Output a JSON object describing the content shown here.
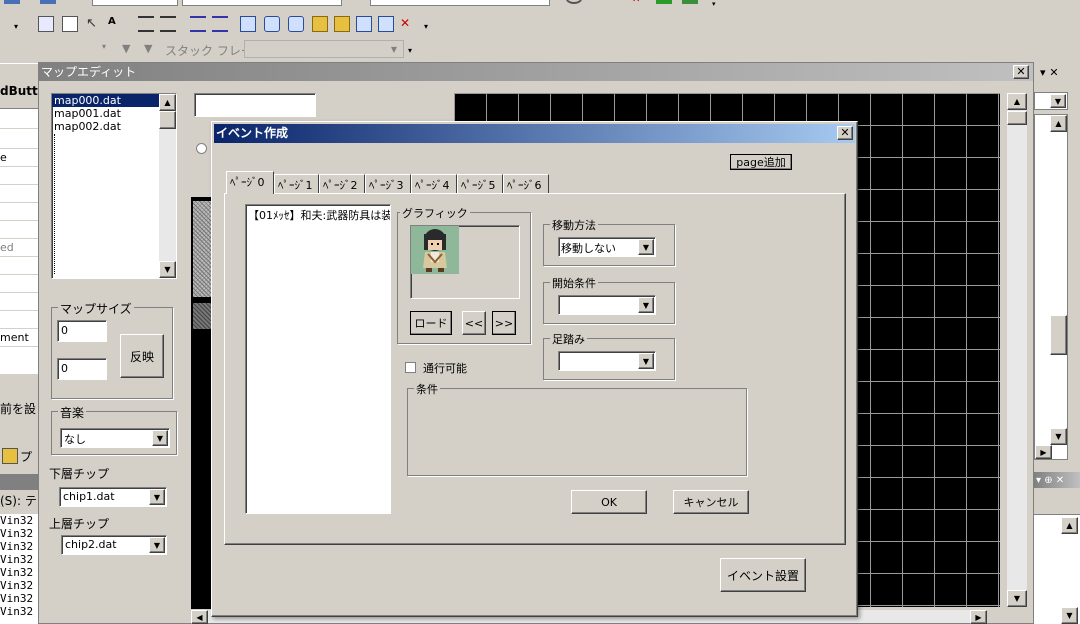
{
  "toolbar": {
    "stack_frame_label": "スタック フレーム"
  },
  "left_panel": {
    "fragments": [
      "dButto",
      "e",
      "ed",
      "ment",
      "前を設",
      "プ",
      "(S): テ"
    ],
    "win32_items": [
      "Vin32",
      "Vin32",
      "Vin32",
      "Vin32",
      "Vin32",
      "Vin32",
      "Vin32",
      "Vin32"
    ]
  },
  "map_editor": {
    "title": "マップエディット",
    "close_glyph": "✕",
    "files": [
      "map000.dat",
      "map001.dat",
      "map002.dat"
    ],
    "map_size_label": "マップサイズ",
    "width_value": "0",
    "height_value": "0",
    "apply_button": "反映",
    "music_label": "音楽",
    "music_value": "なし",
    "lower_chip_label": "下層チップ",
    "lower_chip_value": "chip1.dat",
    "upper_chip_label": "上層チップ",
    "upper_chip_value": "chip2.dat"
  },
  "event_dialog": {
    "title": "イベント作成",
    "close_glyph": "✕",
    "add_page_button": "page追加",
    "tabs": [
      "ﾍﾟｰｼﾞ0",
      "ﾍﾟｰｼﾞ1",
      "ﾍﾟｰｼﾞ2",
      "ﾍﾟｰｼﾞ3",
      "ﾍﾟｰｼﾞ4",
      "ﾍﾟｰｼﾞ5",
      "ﾍﾟｰｼﾞ6"
    ],
    "command_item": "【01ﾒｯｾ】和夫:武器防具は装",
    "graphic_label": "グラフィック",
    "load_button": "ロード",
    "prev_button": "<<",
    "next_button": ">>",
    "passable_label": "通行可能",
    "move_method_label": "移動方法",
    "move_method_value": "移動しない",
    "start_condition_label": "開始条件",
    "start_condition_value": "",
    "step_label": "足踏み",
    "step_value": "",
    "condition_label": "条件",
    "ok_button": "OK",
    "cancel_button": "キャンセル",
    "place_event_button": "イベント設置"
  },
  "right_panel": {
    "top_controls": "▾ ✕",
    "tiny_buttons": "▾ ⊕ ✕"
  }
}
